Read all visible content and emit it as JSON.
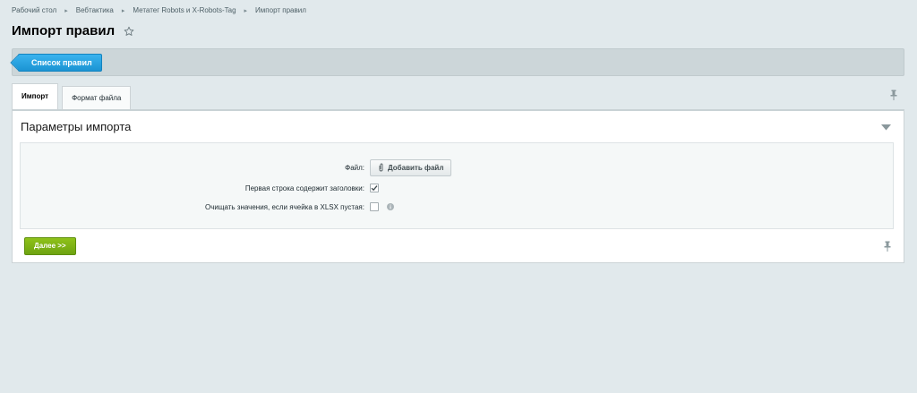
{
  "breadcrumb": {
    "items": [
      "Рабочий стол",
      "Вебтактика",
      "Метатег Robots и X-Robots-Tag",
      "Импорт правил"
    ]
  },
  "header": {
    "title": "Импорт правил"
  },
  "toolbar": {
    "back_label": "Список правил"
  },
  "tabs": [
    {
      "label": "Импорт",
      "active": true
    },
    {
      "label": "Формат файла",
      "active": false
    }
  ],
  "section": {
    "title": "Параметры импорта",
    "fields": {
      "file_label": "Файл:",
      "add_file_label": "Добавить файл",
      "first_row_label": "Первая строка содержит заголовки:",
      "first_row_checked": true,
      "clear_values_label": "Очищать значения, если ячейка в XLSX пустая:",
      "clear_values_checked": false
    }
  },
  "actions": {
    "next_label": "Далее >>"
  },
  "colors": {
    "accent_blue": "#1b94d3",
    "accent_green": "#7ab317",
    "background": "#e1e9ec"
  }
}
